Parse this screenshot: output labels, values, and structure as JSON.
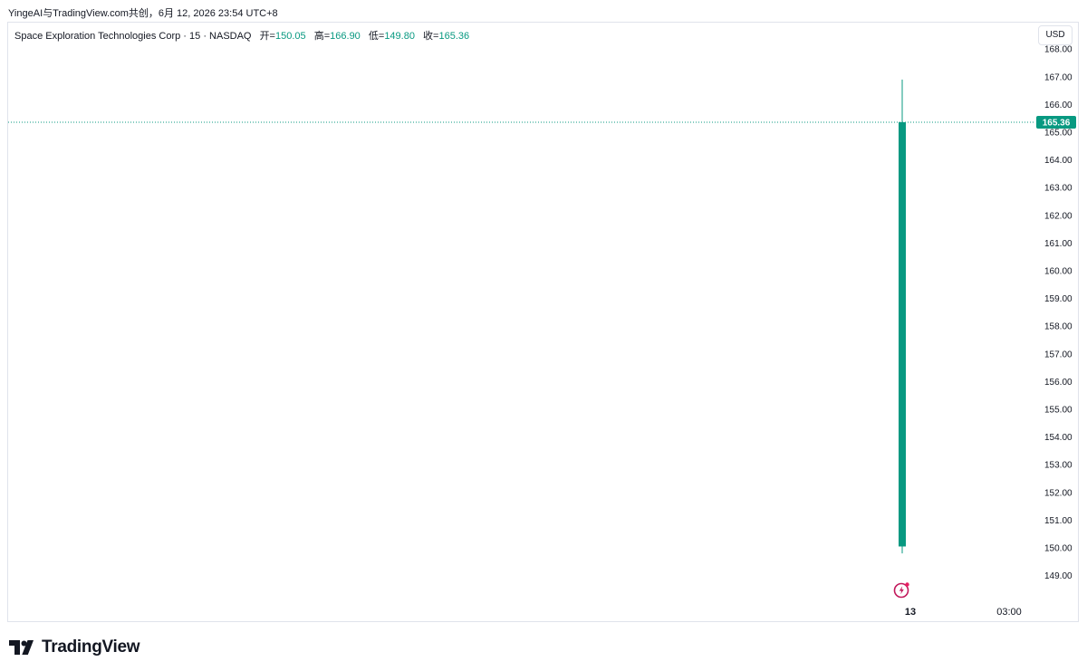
{
  "caption": "YingeAI与TradingView.com共创，6月 12, 2026 23:54 UTC+8",
  "legend": {
    "symbol": "Space Exploration Technologies Corp · 15 · NASDAQ",
    "open_label": "开=",
    "open_value": "150.05",
    "high_label": "高=",
    "high_value": "166.90",
    "low_label": "低=",
    "low_value": "149.80",
    "close_label": "收=",
    "close_value": "165.36"
  },
  "currency_button": "USD",
  "brand": "TradingView",
  "icons": {
    "brand_logo": "tradingview-logo-icon",
    "event": "lightning-event-icon"
  },
  "colors": {
    "up": "#089981",
    "event": "#c2185b",
    "grid_border": "#e0e3eb"
  },
  "chart_data": {
    "type": "candlestick",
    "title": "Space Exploration Technologies Corp · 15 · NASDAQ",
    "candles": [
      {
        "time": "13",
        "open": 150.05,
        "high": 166.9,
        "low": 149.8,
        "close": 165.36
      }
    ],
    "last_price": "165.36",
    "y_ticks": [
      "168.00",
      "167.00",
      "166.00",
      "165.00",
      "164.00",
      "163.00",
      "162.00",
      "161.00",
      "160.00",
      "159.00",
      "158.00",
      "157.00",
      "156.00",
      "155.00",
      "154.00",
      "153.00",
      "152.00",
      "151.00",
      "150.00",
      "149.00"
    ],
    "x_ticks": [
      "13",
      "03:00"
    ],
    "y_range": [
      148.5,
      168.0
    ],
    "grid": false,
    "price_line": "dotted"
  }
}
